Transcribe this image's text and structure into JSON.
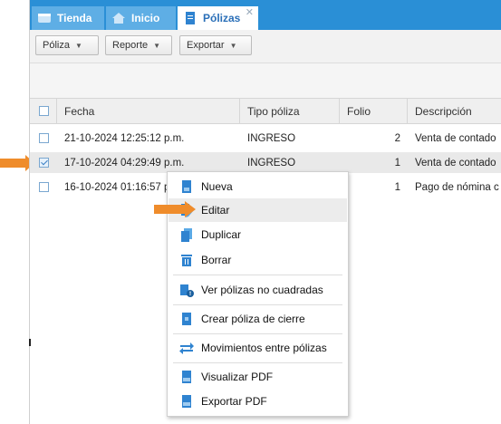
{
  "tabs": [
    {
      "label": "Tienda",
      "icon": "store-icon"
    },
    {
      "label": "Inicio",
      "icon": "home-icon"
    },
    {
      "label": "Pólizas",
      "icon": "document-icon",
      "close": "✕"
    }
  ],
  "toolbar": {
    "poliza_label": "Póliza",
    "reporte_label": "Reporte",
    "exportar_label": "Exportar"
  },
  "grid": {
    "columns": [
      "Fecha",
      "Tipo póliza",
      "Folio",
      "Descripción"
    ],
    "rows": [
      {
        "fecha": "21-10-2024 12:25:12 p.m.",
        "tipo": "INGRESO",
        "folio": "2",
        "descripcion": "Venta de contado",
        "checked": false
      },
      {
        "fecha": "17-10-2024 04:29:49 p.m.",
        "tipo": "INGRESO",
        "folio": "1",
        "descripcion": "Venta de contado",
        "checked": true
      },
      {
        "fecha": "16-10-2024 01:16:57 p.m.",
        "tipo": "",
        "folio": "1",
        "descripcion": "Pago de nómina c",
        "checked": false
      }
    ]
  },
  "context_menu": {
    "items": [
      {
        "label": "Nueva",
        "icon": "new-document-icon"
      },
      {
        "label": "Editar",
        "icon": "edit-icon"
      },
      {
        "label": "Duplicar",
        "icon": "duplicate-icon"
      },
      {
        "label": "Borrar",
        "icon": "trash-icon"
      },
      {
        "label": "Ver pólizas no cuadradas",
        "icon": "unbalanced-documents-icon"
      },
      {
        "label": "Crear póliza de cierre",
        "icon": "closing-document-icon"
      },
      {
        "label": "Movimientos entre pólizas",
        "icon": "transfer-arrows-icon"
      },
      {
        "label": "Visualizar PDF",
        "icon": "pdf-view-icon"
      },
      {
        "label": "Exportar PDF",
        "icon": "pdf-export-icon"
      }
    ]
  },
  "colors": {
    "tabbar": "#2a8fd6",
    "accent_arrow": "#ef8c2b",
    "icon_blue": "#2f83d0"
  }
}
